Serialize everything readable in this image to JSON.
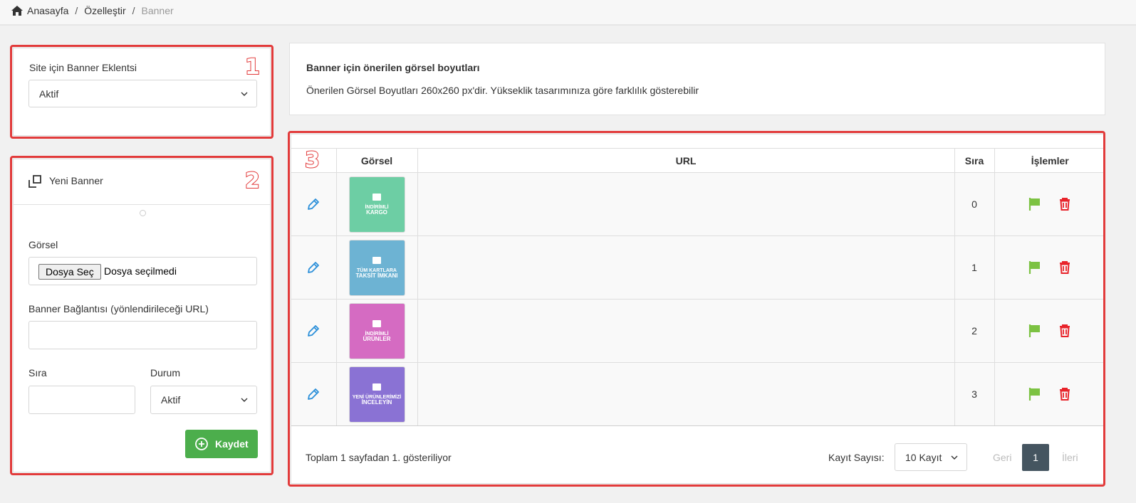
{
  "breadcrumb": {
    "home": "Anasayfa",
    "customize": "Özelleştir",
    "current": "Banner"
  },
  "plugin_card": {
    "label": "Site için Banner Eklentsi",
    "value": "Aktif",
    "marker": "1"
  },
  "new_banner": {
    "title": "Yeni Banner",
    "marker": "2",
    "image_label": "Görsel",
    "file_button": "Dosya Seç",
    "file_status": "Dosya seçilmedi",
    "url_label": "Banner Bağlantısı (yönlendirileceği URL)",
    "url_value": "",
    "order_label": "Sıra",
    "order_value": "",
    "status_label": "Durum",
    "status_value": "Aktif",
    "save": "Kaydet"
  },
  "info": {
    "title": "Banner için önerilen görsel boyutları",
    "text": "Önerilen Görsel Boyutları 260x260 px'dir. Yükseklik tasarımınıza göre farklılık gösterebilir"
  },
  "table": {
    "marker": "3",
    "headers": {
      "image": "Görsel",
      "url": "URL",
      "order": "Sıra",
      "actions": "İşlemler"
    },
    "rows": [
      {
        "line1": "İNDİRİMLİ",
        "line2": "KARGO",
        "color": "#6dcea4",
        "url": "",
        "order": "0"
      },
      {
        "line1": "TÜM KARTLARA",
        "line2": "TAKSİT İMKANI",
        "color": "#6db3d3",
        "url": "",
        "order": "1"
      },
      {
        "line1": "İNDİRİMLİ",
        "line2": "ÜRÜNLER",
        "color": "#d56bc2",
        "url": "",
        "order": "2"
      },
      {
        "line1": "YENİ ÜRÜNLERİMİZİ",
        "line2": "İNCELEYİN",
        "color": "#8a72d4",
        "url": "",
        "order": "3"
      }
    ]
  },
  "footer": {
    "summary": "Toplam 1 sayfadan 1. gösteriliyor",
    "record_label": "Kayıt Sayısı:",
    "record_value": "10 Kayıt",
    "prev": "Geri",
    "page": "1",
    "next": "İleri"
  },
  "colors": {
    "accent_red": "#e23b3b",
    "save_green": "#4cae4c",
    "flag_green": "#7cc242",
    "delete_red": "#e8232a",
    "edit_blue": "#2b8fd9",
    "page_active": "#455560"
  }
}
